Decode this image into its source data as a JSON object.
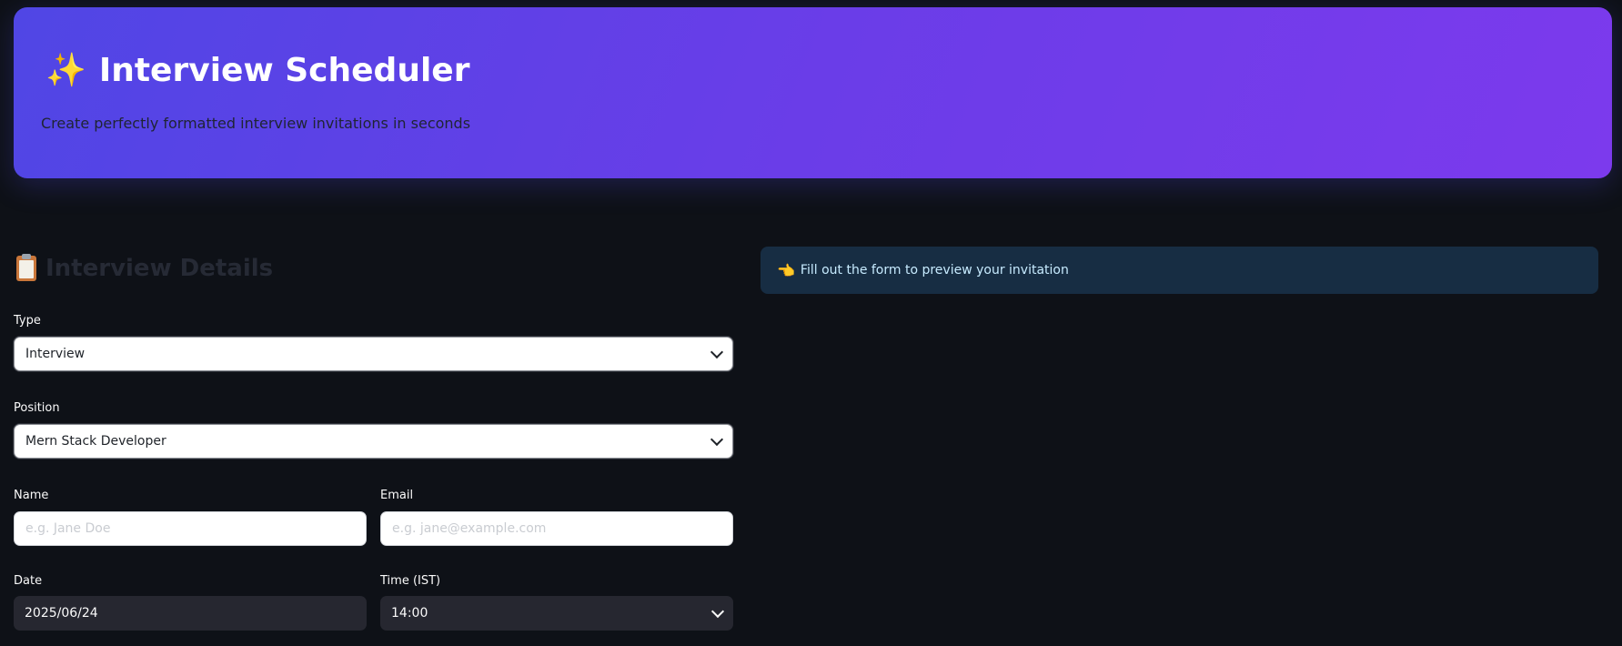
{
  "header": {
    "title": "Interview Scheduler",
    "subtitle": "Create perfectly formatted interview invitations in seconds",
    "icon": "sparkles-icon"
  },
  "form": {
    "section_title": "Interview Details",
    "section_icon": "clipboard-icon",
    "type": {
      "label": "Type",
      "value": "Interview"
    },
    "position": {
      "label": "Position",
      "value": "Mern Stack Developer"
    },
    "name": {
      "label": "Name",
      "placeholder": "e.g. Jane Doe",
      "value": ""
    },
    "email": {
      "label": "Email",
      "placeholder": "e.g. jane@example.com",
      "value": ""
    },
    "date": {
      "label": "Date",
      "value": "2025/06/24"
    },
    "time": {
      "label": "Time (IST)",
      "value": "14:00"
    }
  },
  "preview": {
    "info_text": "Fill out the form to preview your invitation",
    "info_icon": "pointing-hand-icon"
  },
  "colors": {
    "background": "#0e1117",
    "hero_gradient_start": "#5046e5",
    "hero_gradient_end": "#7c3aed",
    "info_background": "#172d43",
    "info_text": "#c7ebff"
  }
}
